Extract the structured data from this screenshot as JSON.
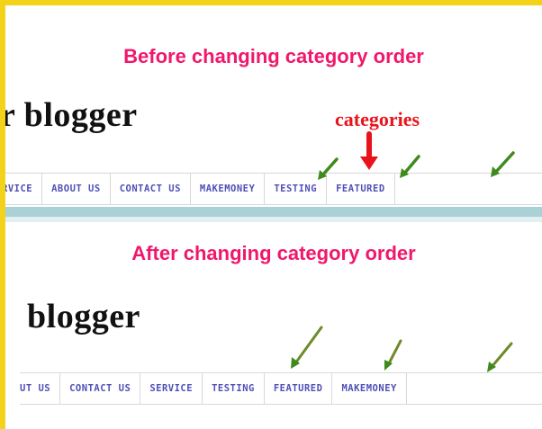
{
  "before": {
    "heading": "Before changing category order",
    "blog_title": "r blogger",
    "categories_label": "categories",
    "menu": [
      "RVICE",
      "ABOUT US",
      "CONTACT US",
      "MAKEMONEY",
      "TESTING",
      "FEATURED"
    ]
  },
  "after": {
    "heading": "After changing category order",
    "blog_title": "blogger",
    "menu": [
      "UT US",
      "CONTACT US",
      "SERVICE",
      "TESTING",
      "FEATURED",
      "MAKEMONEY"
    ]
  },
  "colors": {
    "frame": "#f2d31a",
    "heading": "#f0186c",
    "categories_label": "#e8141a",
    "menu_text": "#5050b8",
    "arrow_green": "#3f8a1c",
    "arrow_red": "#e8141a",
    "stripe": "#a9d1d6"
  },
  "icons": [
    "arrow-green-icon",
    "arrow-red-icon"
  ]
}
